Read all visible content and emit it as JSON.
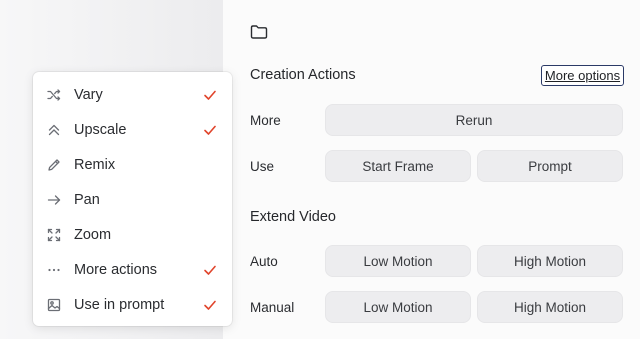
{
  "menu": {
    "items": [
      {
        "label": "Vary",
        "icon": "shuffle-icon",
        "checked": true
      },
      {
        "label": "Upscale",
        "icon": "double-chevron-up-icon",
        "checked": true
      },
      {
        "label": "Remix",
        "icon": "pencil-icon",
        "checked": false
      },
      {
        "label": "Pan",
        "icon": "arrow-right-icon",
        "checked": false
      },
      {
        "label": "Zoom",
        "icon": "expand-corners-icon",
        "checked": false
      },
      {
        "label": "More actions",
        "icon": "ellipsis-icon",
        "checked": true
      },
      {
        "label": "Use in prompt",
        "icon": "image-icon",
        "checked": true
      }
    ],
    "check_color": "#e0442b"
  },
  "panel": {
    "creation": {
      "title": "Creation Actions",
      "more_options": "More options",
      "more_label": "More",
      "rerun": "Rerun",
      "use_label": "Use",
      "start_frame": "Start Frame",
      "prompt": "Prompt"
    },
    "extend": {
      "title": "Extend Video",
      "auto_label": "Auto",
      "manual_label": "Manual",
      "low_motion": "Low Motion",
      "high_motion": "High Motion"
    }
  }
}
